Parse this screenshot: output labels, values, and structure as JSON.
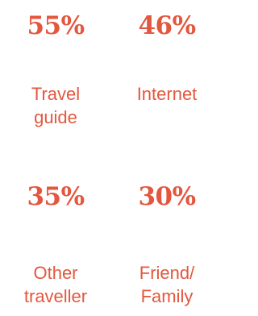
{
  "colors": {
    "accent": "#e4573f",
    "background": "#ffffff"
  },
  "stats": [
    {
      "percent": "55%",
      "label_lines": [
        "Travel",
        "guide"
      ]
    },
    {
      "percent": "46%",
      "label_lines": [
        "Internet"
      ]
    },
    {
      "percent": "35%",
      "label_lines": [
        "Other",
        "traveller"
      ]
    },
    {
      "percent": "30%",
      "label_lines": [
        "Friend/",
        "Family"
      ]
    }
  ]
}
